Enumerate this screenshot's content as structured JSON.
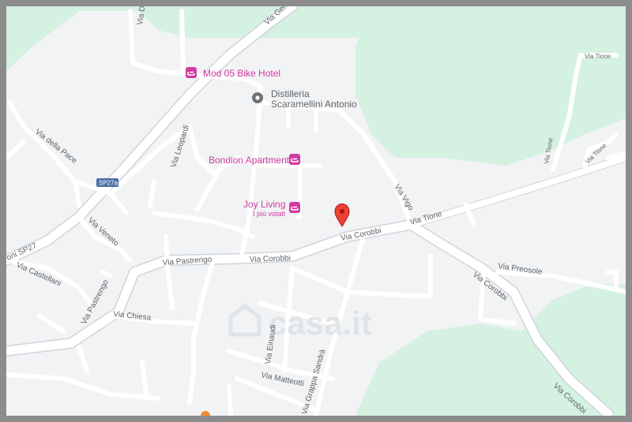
{
  "map": {
    "colors": {
      "land": "#f1f3f4",
      "park": "#d4f1e1",
      "road": "#ffffff",
      "road_outline": "#cfd5db",
      "label": "#5f6368",
      "lodging": "#d23ba1",
      "marker": "#ea4335",
      "watermark": "#dfe3e6"
    },
    "streets": {
      "via_gen": "Via Gene",
      "via_d": "Via D",
      "via_della_pace": "Via della Pace",
      "via_leopardi": "Via Leopardi",
      "via_veneto": "Via Veneto",
      "via_castellani": "Via Castellani",
      "via_pastrengo_1": "Via Pastrengo",
      "via_pastrengo_2": "Via Pastrengo",
      "via_chiesa": "Via Chiesa",
      "via_corobbi_1": "Via Corobbi",
      "via_corobbi_2": "Via Corobbi",
      "via_corobbi_3": "Via Corobbi",
      "via_corobbi_4": "Via Corobbi",
      "via_tione_1": "Via Tione",
      "via_tione_2": "Via Tione",
      "via_vigo": "Via Vigo",
      "via_preosole": "Via Preosole",
      "via_einaudi": "Via Einaudi",
      "via_matteotti": "Via Matteotti",
      "via_grappa": "Via Grappa Sandrà",
      "sp27": "oni SP27"
    },
    "shields": {
      "sp27a": "SP27a"
    },
    "pois": {
      "mod05": "Mod 05 Bike Hotel",
      "distilleria_1": "Distilleria",
      "distilleria_2": "Scaramellini Antonio",
      "bondion": "Bondion Apartment",
      "joy_living": "Joy Living",
      "joy_sub": "I più votati"
    },
    "watermark": "casa.it"
  }
}
